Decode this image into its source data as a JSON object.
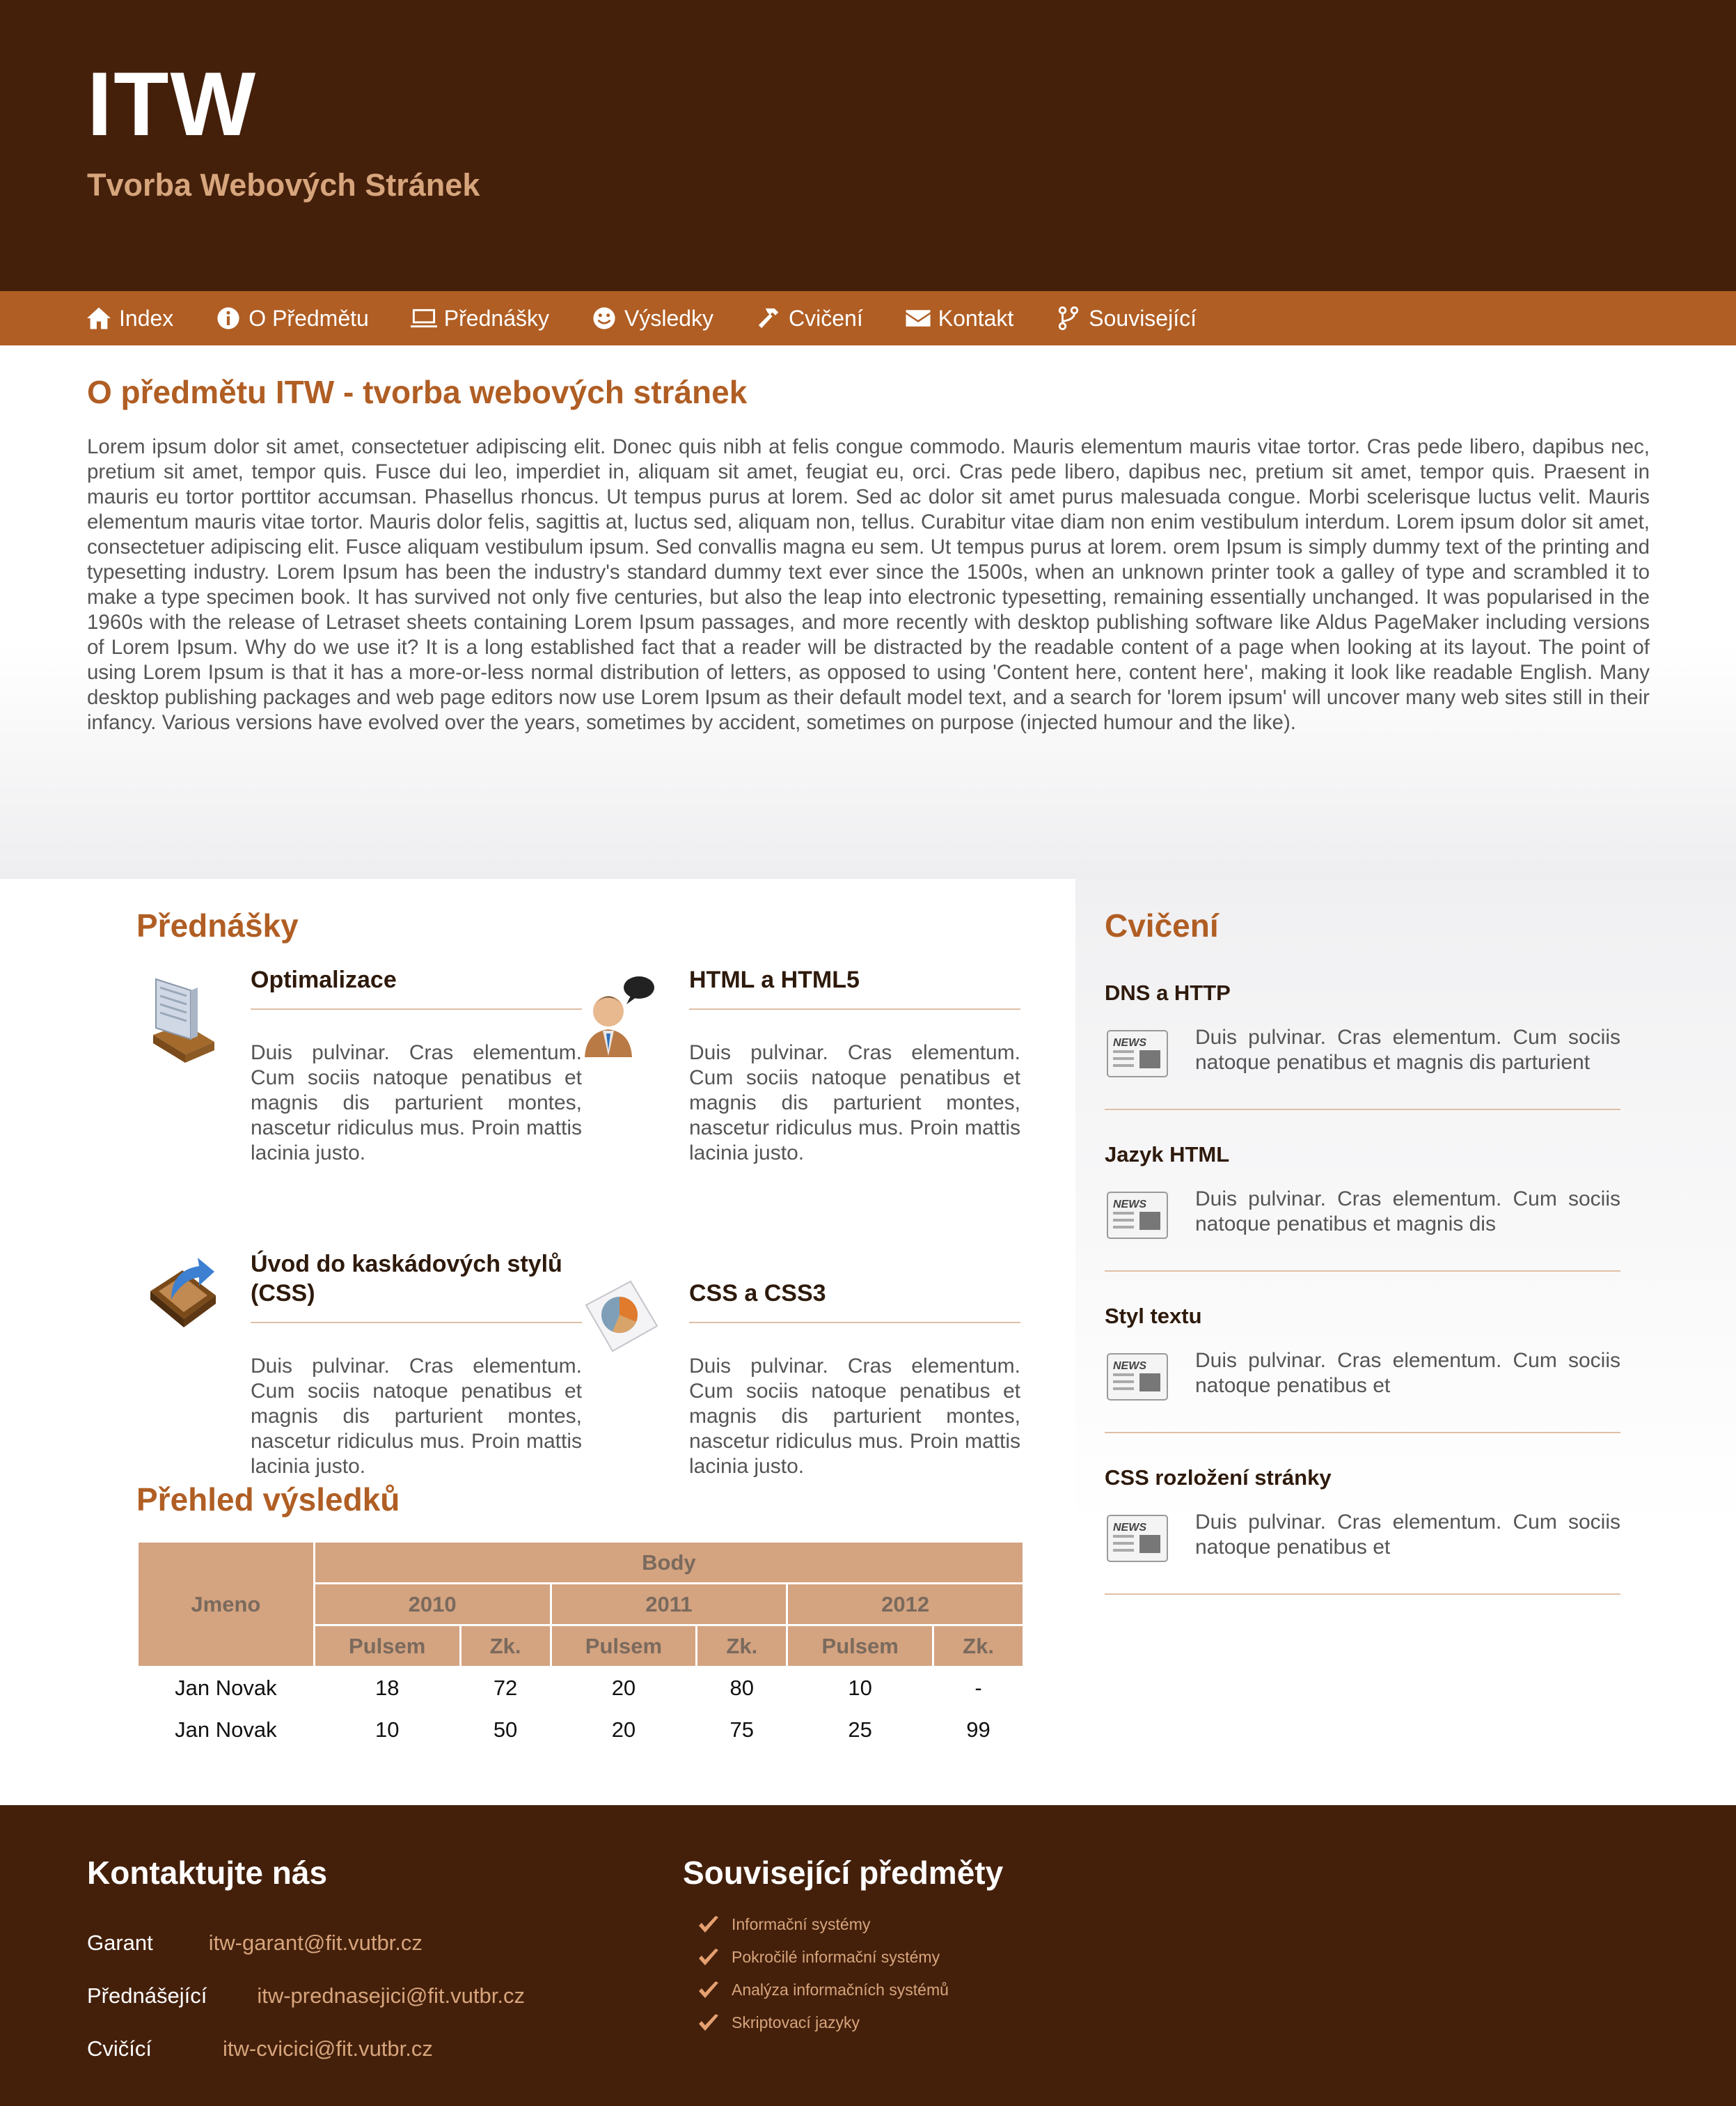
{
  "header": {
    "title": "ITW",
    "subtitle": "Tvorba Webových Stránek"
  },
  "nav": [
    {
      "label": "Index",
      "icon": "home-icon"
    },
    {
      "label": "O Předmětu",
      "icon": "info-icon"
    },
    {
      "label": "Přednášky",
      "icon": "monitor-icon"
    },
    {
      "label": "Výsledky",
      "icon": "smiley-icon"
    },
    {
      "label": "Cvičení",
      "icon": "hammer-icon"
    },
    {
      "label": "Kontakt",
      "icon": "envelope-icon"
    },
    {
      "label": "Související",
      "icon": "branch-icon"
    }
  ],
  "about": {
    "title": "O předmětu ITW - tvorba webových stránek",
    "text": "Lorem ipsum dolor sit amet, consectetuer adipiscing elit. Donec quis nibh at felis congue commodo. Mauris elementum mauris vitae tortor. Cras pede libero, dapibus nec, pretium sit amet, tempor quis. Fusce dui leo, imperdiet in, aliquam sit amet, feugiat eu, orci. Cras pede libero, dapibus nec, pretium sit amet, tempor quis. Praesent in mauris eu tortor porttitor accumsan. Phasellus rhoncus. Ut tempus purus at lorem. Sed ac dolor sit amet purus malesuada congue. Morbi scelerisque luctus velit. Mauris elementum mauris vitae tortor. Mauris dolor felis, sagittis at, luctus sed, aliquam non, tellus. Curabitur vitae diam non enim vestibulum interdum. Lorem ipsum dolor sit amet, consectetuer adipiscing elit. Fusce aliquam vestibulum ipsum. Sed convallis magna eu sem. Ut tempus purus at lorem. orem Ipsum is simply dummy text of the printing and typesetting industry. Lorem Ipsum has been the industry's standard dummy text ever since the 1500s, when an unknown printer took a galley of type and scrambled it to make a type specimen book. It has survived not only five centuries, but also the leap into electronic typesetting, remaining essentially unchanged. It was popularised in the 1960s with the release of Letraset sheets containing Lorem Ipsum passages, and more recently with desktop publishing software like Aldus PageMaker including versions of Lorem Ipsum. Why do we use it? It is a long established fact that a reader will be distracted by the readable content of a page when looking at its layout. The point of using Lorem Ipsum is that it has a more-or-less normal distribution of letters, as opposed to using 'Content here, content here', making it look like readable English. Many desktop publishing packages and web page editors now use Lorem Ipsum as their default model text, and a search for 'lorem ipsum' will uncover many web sites still in their infancy. Various versions have evolved over the years, sometimes by accident, sometimes on purpose (injected humour and the like)."
  },
  "lectures": {
    "title": "Přednášky",
    "items": [
      {
        "title": "Optimalizace",
        "icon": "books-icon",
        "text": "Duis pulvinar. Cras elementum. Cum sociis natoque penatibus et magnis dis parturient montes, nascetur ridiculus mus. Proin mattis lacinia justo."
      },
      {
        "title": "HTML a HTML5",
        "icon": "speaker-person-icon",
        "text": "Duis pulvinar. Cras elementum. Cum sociis natoque penatibus et magnis dis parturient montes, nascetur ridiculus mus. Proin mattis lacinia justo."
      },
      {
        "title": "Úvod do kaskádových stylů (CSS)",
        "icon": "tray-arrow-icon",
        "text": "Duis pulvinar. Cras elementum. Cum sociis natoque penatibus et magnis dis parturient montes, nascetur ridiculus mus. Proin mattis lacinia justo."
      },
      {
        "title": "CSS a CSS3",
        "icon": "pie-document-icon",
        "text": "Duis pulvinar. Cras elementum. Cum sociis natoque penatibus et magnis dis parturient montes, nascetur ridiculus mus. Proin mattis lacinia justo."
      }
    ]
  },
  "results": {
    "title": "Přehled výsledků",
    "name_header": "Jmeno",
    "body_header": "Body",
    "years": [
      "2010",
      "2011",
      "2012"
    ],
    "sub_headers": [
      "Pulsem",
      "Zk."
    ],
    "rows": [
      [
        "Jan Novak",
        "18",
        "72",
        "20",
        "80",
        "10",
        "-"
      ],
      [
        "Jan Novak",
        "10",
        "50",
        "20",
        "75",
        "25",
        "99"
      ]
    ]
  },
  "exercises": {
    "title": "Cvičení",
    "items": [
      {
        "title": "DNS a HTTP",
        "icon": "news-icon",
        "text": "Duis pulvinar. Cras elementum. Cum sociis natoque penatibus et magnis dis parturient"
      },
      {
        "title": "Jazyk HTML",
        "icon": "news-icon",
        "text": "Duis pulvinar. Cras elementum. Cum sociis natoque penatibus et magnis dis"
      },
      {
        "title": "Styl textu",
        "icon": "news-icon",
        "text": "Duis pulvinar. Cras elementum. Cum sociis natoque penatibus et"
      },
      {
        "title": "CSS rozložení stránky",
        "icon": "news-icon",
        "text": "Duis pulvinar. Cras elementum. Cum sociis natoque penatibus et"
      }
    ]
  },
  "footer": {
    "contact_title": "Kontaktujte nás",
    "contacts": [
      {
        "label": "Garant",
        "email": "itw-garant@fit.vutbr.cz"
      },
      {
        "label": "Přednášející",
        "email": "itw-prednasejici@fit.vutbr.cz"
      },
      {
        "label": "Cvičící",
        "email": "itw-cvicici@fit.vutbr.cz"
      }
    ],
    "related_title": "Související předměty",
    "related": [
      "Informační systémy",
      "Pokročilé informační systémy",
      "Analýza informačních systémů",
      "Skriptovací jazyky"
    ]
  },
  "colors": {
    "header_bg": "#44200b",
    "nav_bg": "#b05e24",
    "accent": "#b05e24",
    "subtitle": "#d7a57c",
    "table_header": "#d4a380"
  }
}
